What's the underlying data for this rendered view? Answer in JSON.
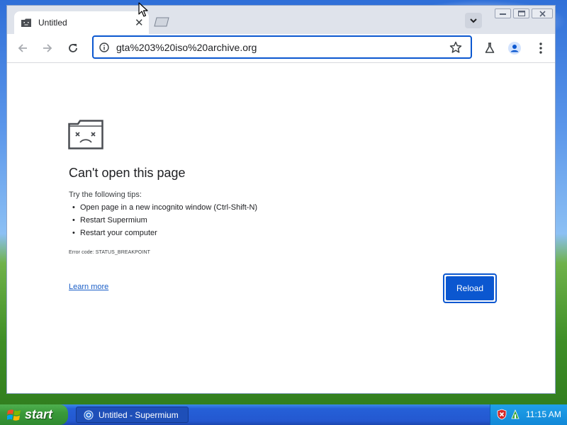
{
  "browser": {
    "tab": {
      "title": "Untitled"
    },
    "omnibox": {
      "url": "gta%203%20iso%20archive.org"
    }
  },
  "error_page": {
    "title": "Can't open this page",
    "tips_heading": "Try the following tips:",
    "tips": [
      "Open page in a new incognito window (Ctrl-Shift-N)",
      "Restart Supermium",
      "Restart your computer"
    ],
    "error_code": "Error code: STATUS_BREAKPOINT",
    "learn_more": "Learn more",
    "reload_label": "Reload"
  },
  "taskbar": {
    "start_label": "start",
    "task_item_label": "Untitled - Supermium",
    "clock": "11:15 AM"
  },
  "colors": {
    "accent": "#0b57d0",
    "link": "#1a5ec7",
    "tabstrip": "#dfe3eb"
  }
}
